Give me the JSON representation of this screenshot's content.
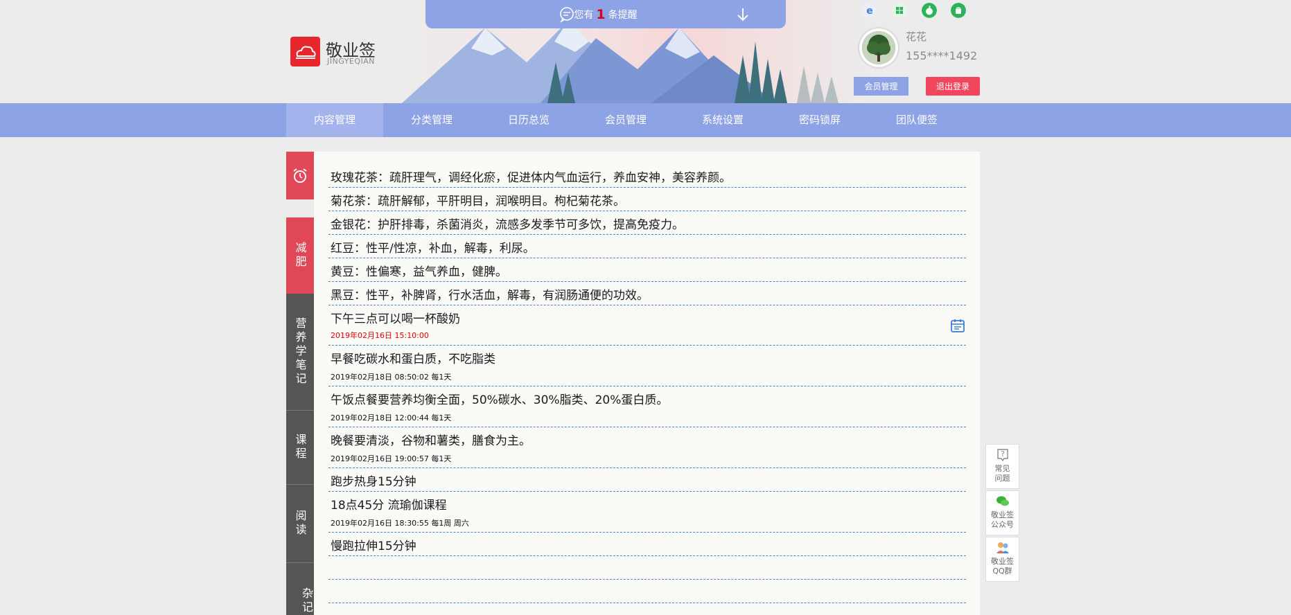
{
  "notice": {
    "prefix": "您有",
    "count": "1",
    "suffix": "条提醒"
  },
  "brand": {
    "name": "敬业签",
    "sub": "JINGYEQIAN"
  },
  "user": {
    "name": "花花",
    "phone": "155****1492"
  },
  "buttons": {
    "member": "会员管理",
    "logout": "退出登录"
  },
  "nav": {
    "items": [
      "内容管理",
      "分类管理",
      "日历总览",
      "会员管理",
      "系统设置",
      "密码锁屏",
      "团队便签"
    ],
    "active": 0
  },
  "sidebar": {
    "tabs": [
      "减肥",
      "营养学笔记",
      "课程",
      "阅读",
      "杂记"
    ],
    "active": 0
  },
  "notes": [
    {
      "text": "玫瑰花茶：疏肝理气，调经化瘀，促进体内气血运行，养血安神，美容养颜。",
      "meta": ""
    },
    {
      "text": "菊花茶：疏肝解郁，平肝明目，润喉明目。枸杞菊花茶。",
      "meta": ""
    },
    {
      "text": "金银花：护肝排毒，杀菌消炎，流感多发季节可多饮，提高免疫力。",
      "meta": ""
    },
    {
      "text": "红豆：性平/性凉，补血，解毒，利尿。",
      "meta": ""
    },
    {
      "text": "黄豆：性偏寒，益气养血，健脾。",
      "meta": ""
    },
    {
      "text": "黑豆：性平，补脾肾，行水活血，解毒，有润肠通便的功效。",
      "meta": ""
    },
    {
      "text": "下午三点可以喝一杯酸奶",
      "meta": "2019年02月16日 15:10:00"
    },
    {
      "text": "早餐吃碳水和蛋白质，不吃脂类",
      "meta": "2019年02月18日 08:50:02 每1天"
    },
    {
      "text": "午饭点餐要营养均衡全面，50%碳水、30%脂类、20%蛋白质。",
      "meta": "2019年02月18日 12:00:44 每1天"
    },
    {
      "text": "晚餐要清淡，谷物和薯类，膳食为主。",
      "meta": "2019年02月16日 19:00:57 每1天"
    },
    {
      "text": "跑步热身15分钟",
      "meta": ""
    },
    {
      "text": "18点45分 流瑜伽课程",
      "meta": "2019年02月16日 18:30:55 每1周 周六"
    },
    {
      "text": "慢跑拉伸15分钟",
      "meta": ""
    }
  ],
  "float": {
    "faq": [
      "常见",
      "问题"
    ],
    "wechat": [
      "敬业签",
      "公众号"
    ],
    "qq": [
      "敬业签",
      "QQ群"
    ]
  },
  "colors": {
    "accent": "#8ea3e6",
    "red": "#e04757",
    "logout": "#f0475f",
    "sidebar_gray": "#555555"
  }
}
